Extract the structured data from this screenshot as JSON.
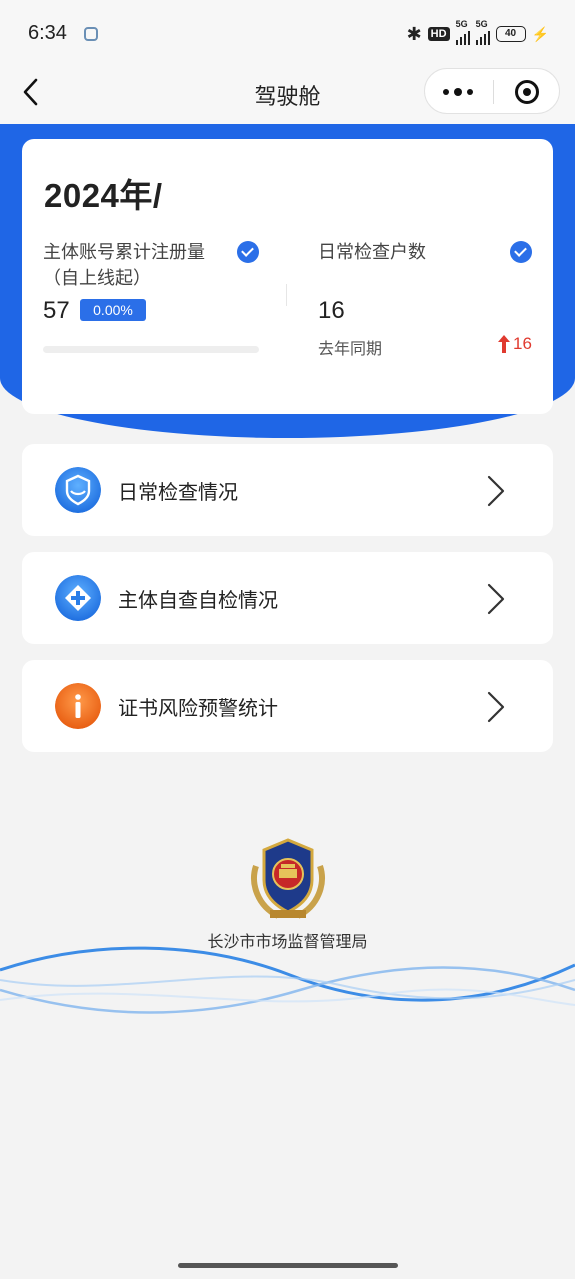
{
  "status_bar": {
    "time": "6:34",
    "hd": "HD",
    "network_1": "5G",
    "network_2": "5G",
    "battery": "40"
  },
  "nav": {
    "title": "驾驶舱"
  },
  "stats": {
    "year": "2024年/",
    "registered": {
      "label": "主体账号累计注册量（自上线起）",
      "value": "57",
      "rate": "0.00%",
      "progress": 0
    },
    "inspections": {
      "label": "日常检查户数",
      "value": "16",
      "compare_label": "去年同期",
      "compare_value": "16",
      "trend": "up"
    }
  },
  "menu": [
    {
      "label": "日常检查情况",
      "icon": "shield-icon",
      "color": "#2a86e8"
    },
    {
      "label": "主体自查自检情况",
      "icon": "plus-diamond-icon",
      "color": "#2a86e8"
    },
    {
      "label": "证书风险预警统计",
      "icon": "info-icon",
      "color": "#ef6b1f"
    }
  ],
  "footer": {
    "organization": "长沙市市场监督管理局"
  },
  "colors": {
    "primary": "#1f66e6",
    "accent_blue": "#2b6fe8",
    "warning_orange": "#ef6b1f",
    "trend_red": "#e03a2f"
  }
}
